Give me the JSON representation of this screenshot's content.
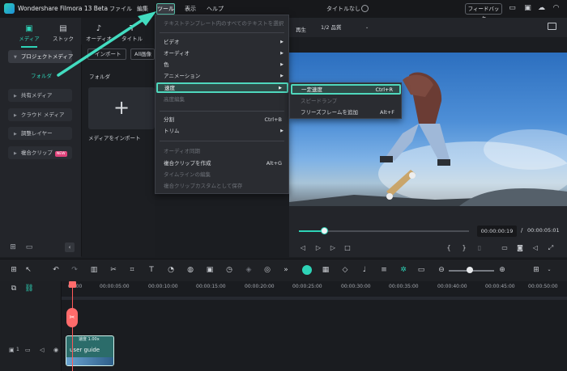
{
  "app": {
    "title": "Wondershare Filmora 13 Beta",
    "menus": [
      "ファイル",
      "編集",
      "ツール",
      "表示",
      "ヘルプ"
    ],
    "document_title": "タイトルなし",
    "feedback_label": "フィードバック"
  },
  "media_panel": {
    "tabs": [
      "メディア",
      "ストック",
      "オーディオ",
      "タイトル"
    ],
    "sidebar": {
      "project_media": "プロジェクトメディア",
      "folder": "フォルダ",
      "shared_media": "共有メディア",
      "cloud_media": "クラウド メディア",
      "adjustment_layer": "調整レイヤー",
      "compound_clip": "複合クリップ",
      "badge": "NEW"
    },
    "import_dropdown": "インポート",
    "filter_dropdown": "All画像",
    "folder_label": "フォルダ",
    "import_caption": "メディアをインポート",
    "plus": "+"
  },
  "tools_menu": {
    "items": [
      {
        "label": "テキストテンプレート内のすべてのテキストを選択",
        "shortcut": "",
        "disabled": true
      },
      {
        "label": "ビデオ",
        "submenu": true
      },
      {
        "label": "オーディオ",
        "submenu": true
      },
      {
        "label": "色",
        "submenu": true
      },
      {
        "label": "アニメーション",
        "submenu": true
      },
      {
        "label": "速度",
        "submenu": true,
        "highlighted": true
      },
      {
        "label": "高度編集",
        "disabled": true
      },
      {
        "label": "分割",
        "shortcut": "Ctrl+B"
      },
      {
        "label": "トリム",
        "submenu": true
      },
      {
        "label": "オーディオ同期",
        "disabled": true
      },
      {
        "label": "複合クリップを作成",
        "shortcut": "Alt+G"
      },
      {
        "label": "タイムラインの編集",
        "disabled": true
      },
      {
        "label": "複合クリップカスタムとして保存",
        "disabled": true
      }
    ]
  },
  "speed_menu": {
    "items": [
      {
        "label": "一定速度",
        "shortcut": "Ctrl+R",
        "highlighted": true
      },
      {
        "label": "スピードランプ",
        "disabled": true
      },
      {
        "label": "フリーズフレームを追加",
        "shortcut": "Alt+F"
      }
    ]
  },
  "player": {
    "play_label": "再生",
    "quality": "1/2 品質",
    "current_time": "00:00:00:19",
    "separator": "/",
    "total_time": "00:00:05:01",
    "progress": 0.15
  },
  "timeline": {
    "ticks": [
      "00:00",
      "00:00:05:00",
      "00:00:10:00",
      "00:00:15:00",
      "00:00:20:00",
      "00:00:25:00",
      "00:00:30:00",
      "00:00:35:00",
      "00:00:40:00",
      "00:00:45:00",
      "00:00:50:00"
    ],
    "clip": {
      "speed": "速度 1.00x",
      "name": "user guide"
    },
    "track_number": "1"
  },
  "colors": {
    "accent": "#2ed3b7",
    "playhead": "#ff6b6b",
    "highlight_border": "#4fd8bd"
  }
}
